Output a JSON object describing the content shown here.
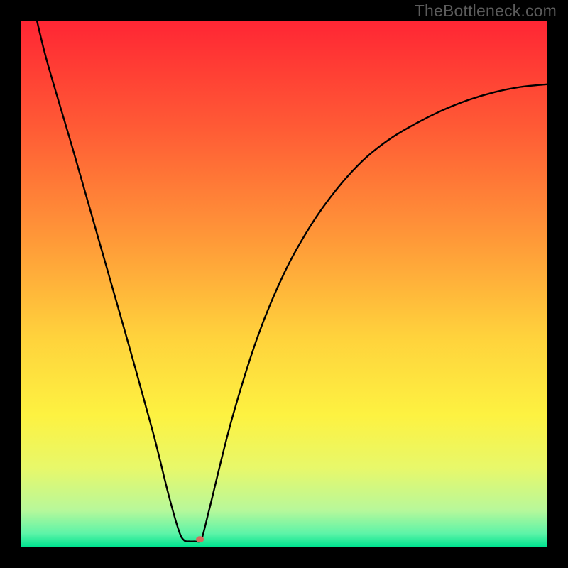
{
  "watermark": "TheBottleneck.com",
  "chart_data": {
    "type": "line",
    "title": "",
    "xlabel": "",
    "ylabel": "",
    "xlim": [
      0,
      100
    ],
    "ylim": [
      0,
      100
    ],
    "grid": false,
    "background": {
      "type": "vertical-gradient",
      "stops": [
        {
          "offset": 0.0,
          "color": "#ff2634"
        },
        {
          "offset": 0.2,
          "color": "#ff5a35"
        },
        {
          "offset": 0.4,
          "color": "#ff9438"
        },
        {
          "offset": 0.6,
          "color": "#ffd23c"
        },
        {
          "offset": 0.75,
          "color": "#fdf241"
        },
        {
          "offset": 0.85,
          "color": "#e8f86a"
        },
        {
          "offset": 0.93,
          "color": "#b8f89a"
        },
        {
          "offset": 0.975,
          "color": "#5df4a8"
        },
        {
          "offset": 1.0,
          "color": "#00e38f"
        }
      ]
    },
    "series": [
      {
        "name": "curve",
        "color": "#000000",
        "points": [
          {
            "x": 3.0,
            "y": 100.0
          },
          {
            "x": 5.0,
            "y": 92.0
          },
          {
            "x": 10.0,
            "y": 75.0
          },
          {
            "x": 15.0,
            "y": 57.5
          },
          {
            "x": 20.0,
            "y": 40.0
          },
          {
            "x": 25.0,
            "y": 22.0
          },
          {
            "x": 28.0,
            "y": 10.0
          },
          {
            "x": 30.0,
            "y": 3.0
          },
          {
            "x": 31.0,
            "y": 1.2
          },
          {
            "x": 32.0,
            "y": 1.0
          },
          {
            "x": 33.0,
            "y": 1.0
          },
          {
            "x": 34.0,
            "y": 1.0
          },
          {
            "x": 34.5,
            "y": 2.0
          },
          {
            "x": 36.0,
            "y": 8.0
          },
          {
            "x": 40.0,
            "y": 24.0
          },
          {
            "x": 45.0,
            "y": 40.0
          },
          {
            "x": 50.0,
            "y": 52.0
          },
          {
            "x": 55.0,
            "y": 61.0
          },
          {
            "x": 60.0,
            "y": 68.0
          },
          {
            "x": 65.0,
            "y": 73.5
          },
          {
            "x": 70.0,
            "y": 77.5
          },
          {
            "x": 75.0,
            "y": 80.5
          },
          {
            "x": 80.0,
            "y": 83.0
          },
          {
            "x": 85.0,
            "y": 85.0
          },
          {
            "x": 90.0,
            "y": 86.5
          },
          {
            "x": 95.0,
            "y": 87.5
          },
          {
            "x": 100.0,
            "y": 88.0
          }
        ]
      }
    ],
    "marker": {
      "x": 34.0,
      "y": 1.4,
      "rx": 5.5,
      "ry": 4.5,
      "color": "#d66a5e"
    }
  }
}
